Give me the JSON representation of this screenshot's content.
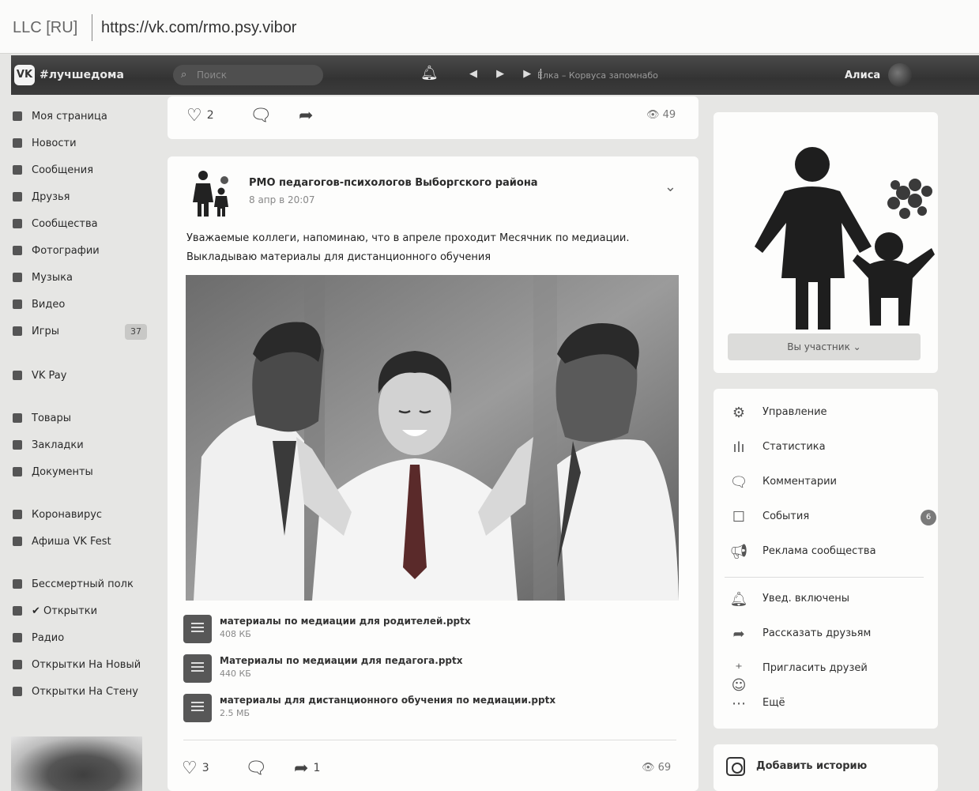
{
  "browser": {
    "cert": "LLC [RU]",
    "url": "https://vk.com/rmo.psy.vibor"
  },
  "header": {
    "logo": "VK",
    "hashtag": "#лучшедома",
    "search_placeholder": "Поиск",
    "bell_icon": "bell-icon",
    "track": "Ёлка – Корвуса запомнабо",
    "user": "Алиса"
  },
  "menu": {
    "items": [
      {
        "label": "Моя страница"
      },
      {
        "label": "Новости"
      },
      {
        "label": "Сообщения"
      },
      {
        "label": "Друзья"
      },
      {
        "label": "Сообщества"
      },
      {
        "label": "Фотографии"
      },
      {
        "label": "Музыка"
      },
      {
        "label": "Видео"
      },
      {
        "label": "Игры",
        "count": "37"
      },
      {
        "label": "VK Pay"
      },
      {
        "label": "Товары"
      },
      {
        "label": "Закладки"
      },
      {
        "label": "Документы"
      },
      {
        "label": "Коронавирус"
      },
      {
        "label": "Афиша VK Fest"
      },
      {
        "label": "Бессмертный полк"
      },
      {
        "label": "✔ Открытки"
      },
      {
        "label": "Радио"
      },
      {
        "label": "Открытки На Новый"
      },
      {
        "label": "Открытки На Стену"
      }
    ]
  },
  "prev_post": {
    "likes": "2",
    "views": "49"
  },
  "post": {
    "group_name": "РМО педагогов-психологов Выборгского района",
    "date": "8 апр в 20:07",
    "text": "Уважаемые коллеги, напоминаю, что в апреле проходит Месячник по медиации. Выкладываю материалы для дистанционного обучения",
    "docs": [
      {
        "name": "материалы по медиации для родителей.pptx",
        "size": "408 КБ"
      },
      {
        "name": "Материалы по медиации для педагога.pptx",
        "size": "440 КБ"
      },
      {
        "name": "материалы для дистанционного обучения по медиации.pptx",
        "size": "2.5 МБ"
      }
    ],
    "likes": "3",
    "shares": "1",
    "views": "69"
  },
  "community": {
    "member_label": "Вы участник ⌄"
  },
  "side_menu": {
    "items": [
      {
        "icon": "gear-icon",
        "label": "Управление"
      },
      {
        "icon": "stats-icon",
        "label": "Статистика"
      },
      {
        "icon": "comment-icon",
        "label": "Комментарии"
      },
      {
        "icon": "events-icon",
        "label": "События",
        "badge": "6"
      },
      {
        "icon": "megaphone-icon",
        "label": "Реклама сообщества"
      },
      {
        "icon": "bell-icon",
        "label": "Увед. включены"
      },
      {
        "icon": "share-icon",
        "label": "Рассказать друзьям"
      },
      {
        "icon": "add-friend-icon",
        "label": "Пригласить друзей"
      },
      {
        "icon": "more-icon",
        "label": "Ещё"
      }
    ]
  },
  "story": {
    "label": "Добавить историю"
  }
}
